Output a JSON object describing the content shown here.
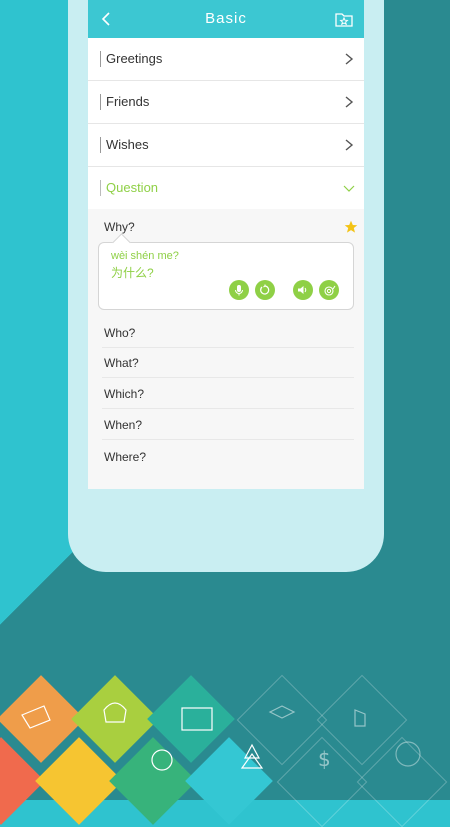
{
  "header": {
    "title": "Basic"
  },
  "categories": [
    {
      "label": "Greetings"
    },
    {
      "label": "Friends"
    },
    {
      "label": "Wishes"
    },
    {
      "label": "Question"
    }
  ],
  "expanded_phrase": {
    "english": "Why?",
    "pinyin": "wèi shén me?",
    "chinese": "为什么?"
  },
  "phrases": [
    "Who?",
    "What?",
    "Which?",
    "When?",
    "Where?"
  ],
  "colors": {
    "accent_teal": "#3cc7d2",
    "accent_green": "#8fd046",
    "star": "#f3c316"
  },
  "icons": [
    "back-icon",
    "favorite-folder-icon",
    "chevron-right-icon",
    "chevron-down-icon",
    "star-icon",
    "microphone-icon",
    "replay-icon",
    "speaker-icon",
    "slow-snail-icon"
  ]
}
